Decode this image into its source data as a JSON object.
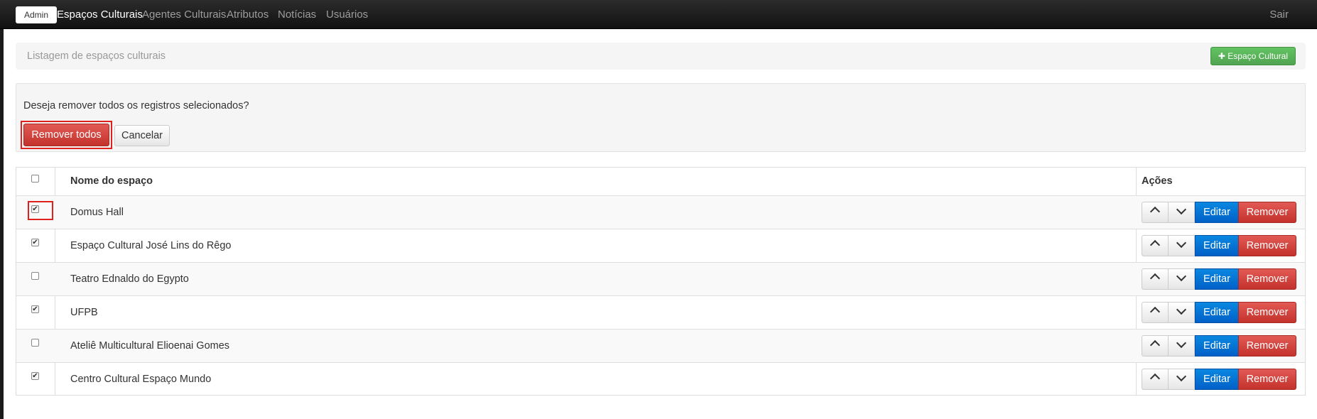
{
  "navbar": {
    "brand": "Admin",
    "items": [
      {
        "label": "Espaços Culturais",
        "active": true
      },
      {
        "label": "Agentes Culturais",
        "active": false
      },
      {
        "label": "Atributos",
        "active": false
      },
      {
        "label": "Notícias",
        "active": false
      },
      {
        "label": "Usuários",
        "active": false
      }
    ],
    "logout": "Sair"
  },
  "header": {
    "title": "Listagem de espaços culturais",
    "add_button": "✚ Espaço Cultural"
  },
  "confirm": {
    "message": "Deseja remover todos os registros selecionados?",
    "remove_all": "Remover todos",
    "cancel": "Cancelar"
  },
  "table": {
    "columns": [
      "Nome do espaço",
      "Ações"
    ],
    "header_checked": false,
    "rows": [
      {
        "name": "Domus Hall",
        "checked": true
      },
      {
        "name": "Espaço Cultural José Lins do Rêgo",
        "checked": true
      },
      {
        "name": "Teatro Ednaldo do Egypto",
        "checked": false
      },
      {
        "name": "UFPB",
        "checked": true
      },
      {
        "name": "Ateliê Multicultural Elioenai Gomes",
        "checked": false
      },
      {
        "name": "Centro Cultural Espaço Mundo",
        "checked": true
      }
    ],
    "actions": {
      "up_icon": "chevron-up-icon",
      "down_icon": "chevron-down-icon",
      "edit": "Editar",
      "remove": "Remover"
    }
  },
  "colors": {
    "navbar": "#1b1b1b",
    "success": "#51a351",
    "danger": "#c4322c",
    "primary": "#0060c8",
    "highlight": "#e0201c"
  }
}
